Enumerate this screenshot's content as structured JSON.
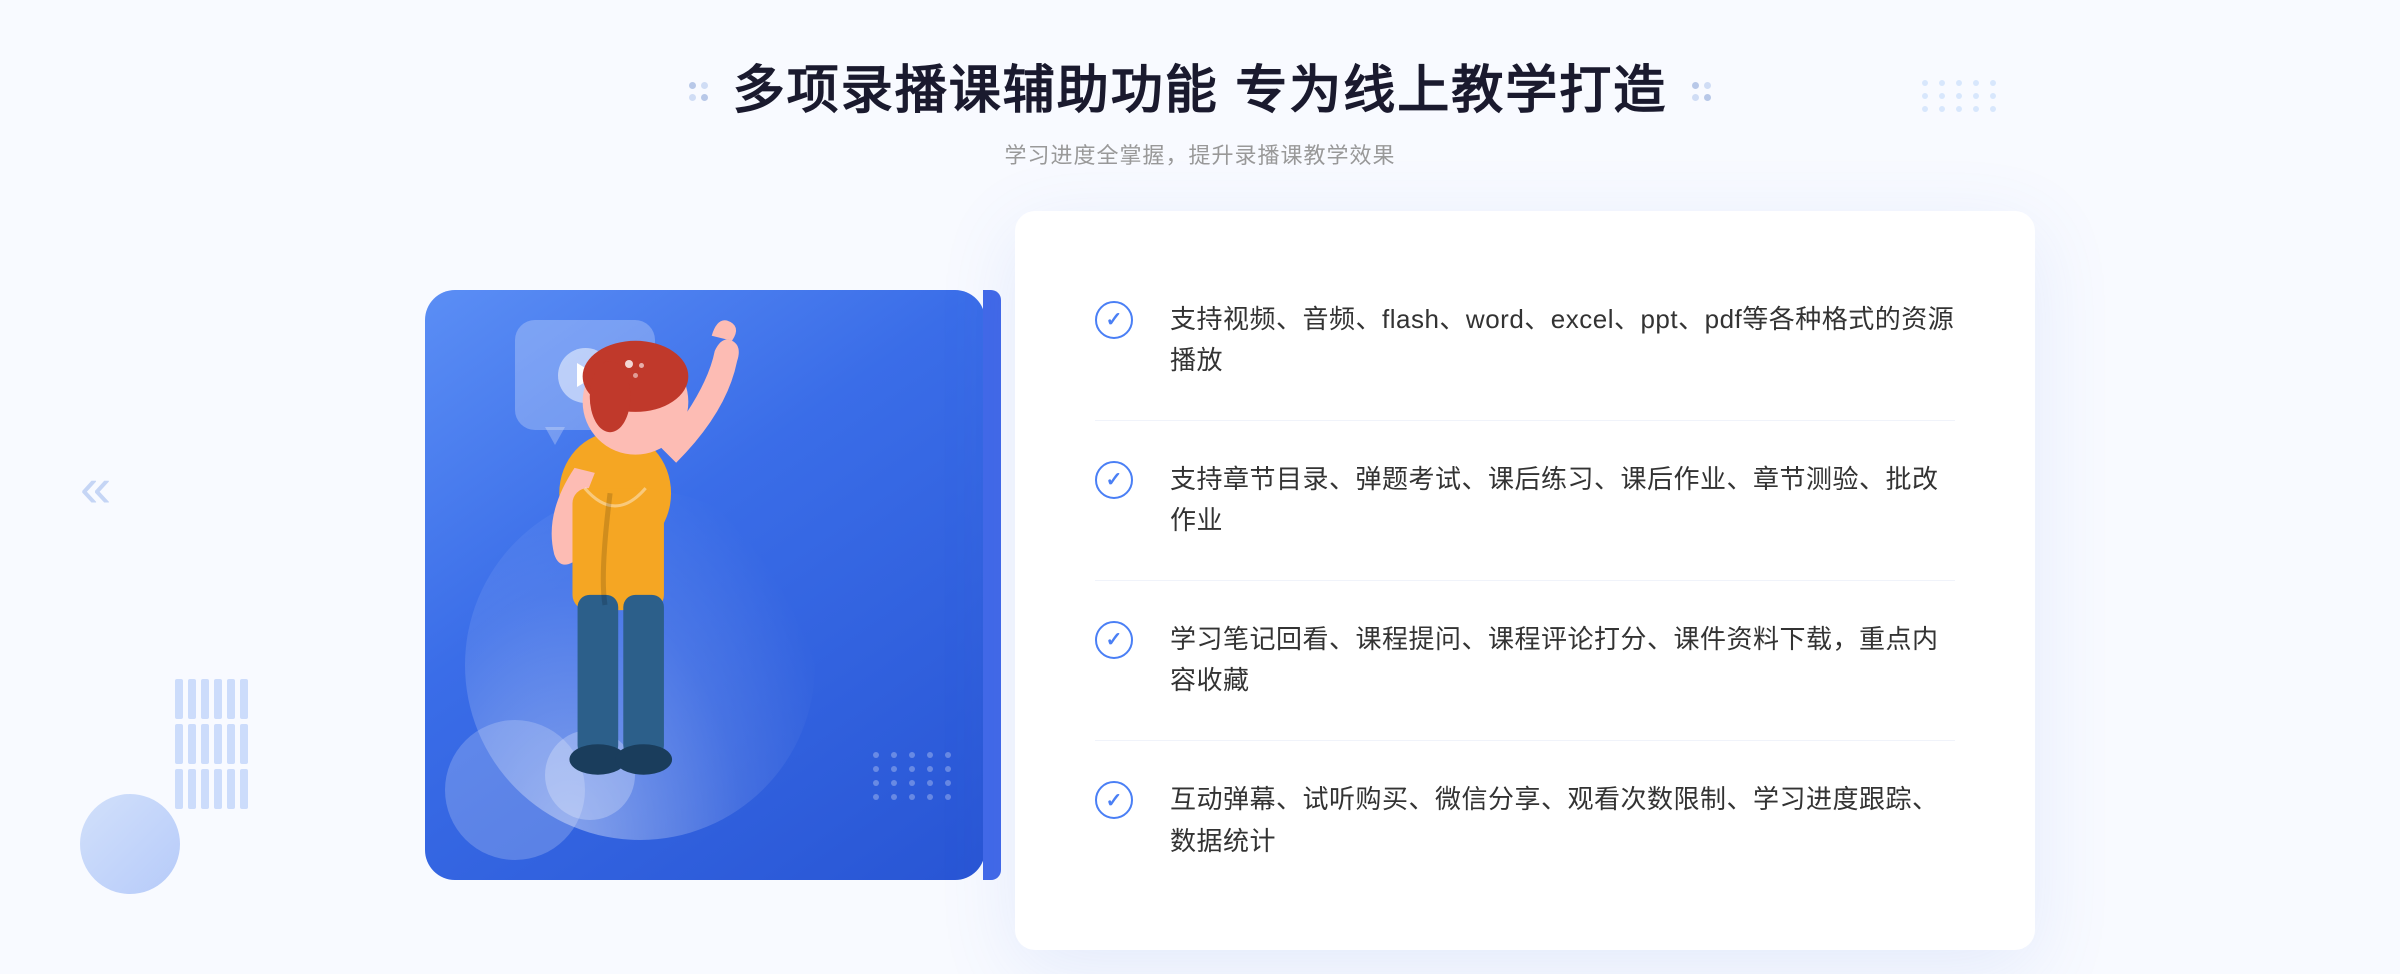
{
  "header": {
    "title": "多项录播课辅助功能 专为线上教学打造",
    "subtitle": "学习进度全掌握，提升录播课教学效果"
  },
  "features": [
    {
      "id": "feature-1",
      "text": "支持视频、音频、flash、word、excel、ppt、pdf等各种格式的资源播放"
    },
    {
      "id": "feature-2",
      "text": "支持章节目录、弹题考试、课后练习、课后作业、章节测验、批改作业"
    },
    {
      "id": "feature-3",
      "text": "学习笔记回看、课程提问、课程评论打分、课件资料下载，重点内容收藏"
    },
    {
      "id": "feature-4",
      "text": "互动弹幕、试听购买、微信分享、观看次数限制、学习进度跟踪、数据统计"
    }
  ],
  "colors": {
    "primary_blue": "#4a7ff5",
    "dark_blue": "#2855d4",
    "light_bg": "#f8faff",
    "text_dark": "#1a1a2e",
    "text_gray": "#999999",
    "text_body": "#333333"
  },
  "icons": {
    "check": "✓",
    "play": "▶",
    "chevron_left": "«"
  }
}
